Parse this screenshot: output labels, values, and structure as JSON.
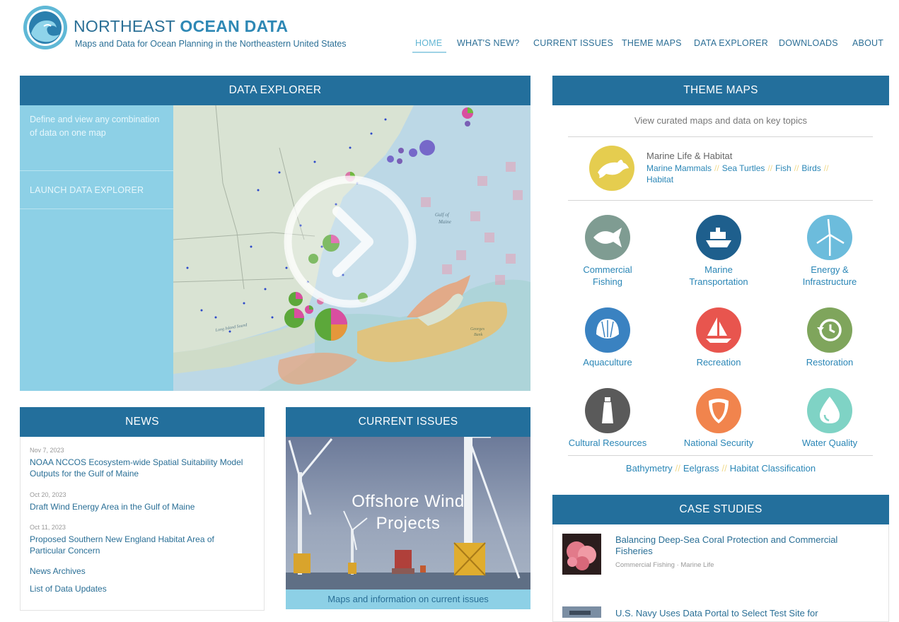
{
  "header": {
    "title_part1": "NORTHEAST",
    "title_part2": "OCEAN DATA",
    "subtitle": "Maps and Data for Ocean Planning in the Northeastern United States",
    "logo_icon": "wave-logo-icon"
  },
  "nav": {
    "items": [
      {
        "label": "HOME",
        "active": true
      },
      {
        "label": "WHAT'S NEW?"
      },
      {
        "label": "CURRENT ISSUES"
      },
      {
        "label": "THEME MAPS"
      },
      {
        "label": "DATA EXPLORER"
      },
      {
        "label": "DOWNLOADS"
      },
      {
        "label": "ABOUT"
      }
    ]
  },
  "data_explorer": {
    "heading": "DATA EXPLORER",
    "description": "Define and view any combination of data on one map",
    "launch_label": "LAUNCH DATA EXPLORER",
    "map_label_gulf": "Gulf of Maine",
    "map_label_long_island": "Long Island Sound",
    "map_label_georges": "Georges Bank"
  },
  "news": {
    "heading": "NEWS",
    "items": [
      {
        "date": "Nov 7, 2023",
        "title": "NOAA NCCOS Ecosystem-wide Spatial Suitability Model Outputs for the Gulf of Maine"
      },
      {
        "date": "Oct 20, 2023",
        "title": "Draft Wind Energy Area in the Gulf of Maine"
      },
      {
        "date": "Oct 11, 2023",
        "title": "Proposed Southern New England Habitat Area of Particular Concern"
      }
    ],
    "archives_label": "News Archives",
    "updates_label": "List of Data Updates"
  },
  "current_issues": {
    "heading": "CURRENT ISSUES",
    "overlay_line1": "Offshore Wind",
    "overlay_line2": "Projects",
    "caption": "Maps and information on current issues"
  },
  "theme_maps": {
    "heading": "THEME MAPS",
    "intro": "View curated maps and data on key topics",
    "featured": {
      "title": "Marine Life & Habitat",
      "links": [
        "Marine Mammals",
        "Sea Turtles",
        "Fish",
        "Birds",
        "Habitat"
      ],
      "icon": "dolphin-icon",
      "color": "#e5cd4f"
    },
    "themes": [
      {
        "label1": "Commercial",
        "label2": "Fishing",
        "icon": "fish-icon",
        "color": "#7f9c92"
      },
      {
        "label1": "Marine",
        "label2": "Transportation",
        "icon": "ship-icon",
        "color": "#1e5f8d"
      },
      {
        "label1": "Energy &",
        "label2": "Infrastructure",
        "icon": "wind-turbine-icon",
        "color": "#6cbcdc"
      },
      {
        "label1": "Aquaculture",
        "label2": "",
        "icon": "shell-icon",
        "color": "#3a82c1"
      },
      {
        "label1": "Recreation",
        "label2": "",
        "icon": "sailboat-icon",
        "color": "#e8554e"
      },
      {
        "label1": "Restoration",
        "label2": "",
        "icon": "restore-icon",
        "color": "#7fa55c"
      },
      {
        "label1": "Cultural Resources",
        "label2": "",
        "icon": "lighthouse-icon",
        "color": "#5a5a5a"
      },
      {
        "label1": "National Security",
        "label2": "",
        "icon": "shield-icon",
        "color": "#f1844d"
      },
      {
        "label1": "Water Quality",
        "label2": "",
        "icon": "water-drop-icon",
        "color": "#7fd3c5"
      }
    ],
    "bottom_links": [
      "Bathymetry",
      "Eelgrass",
      "Habitat Classification"
    ],
    "separator": "//"
  },
  "case_studies": {
    "heading": "CASE STUDIES",
    "items": [
      {
        "title": "Balancing Deep-Sea Coral Protection and Commercial Fisheries",
        "tags": "Commercial Fishing · Marine Life"
      },
      {
        "title": "U.S. Navy Uses Data Portal to Select Test Site for",
        "tags": ""
      }
    ]
  }
}
